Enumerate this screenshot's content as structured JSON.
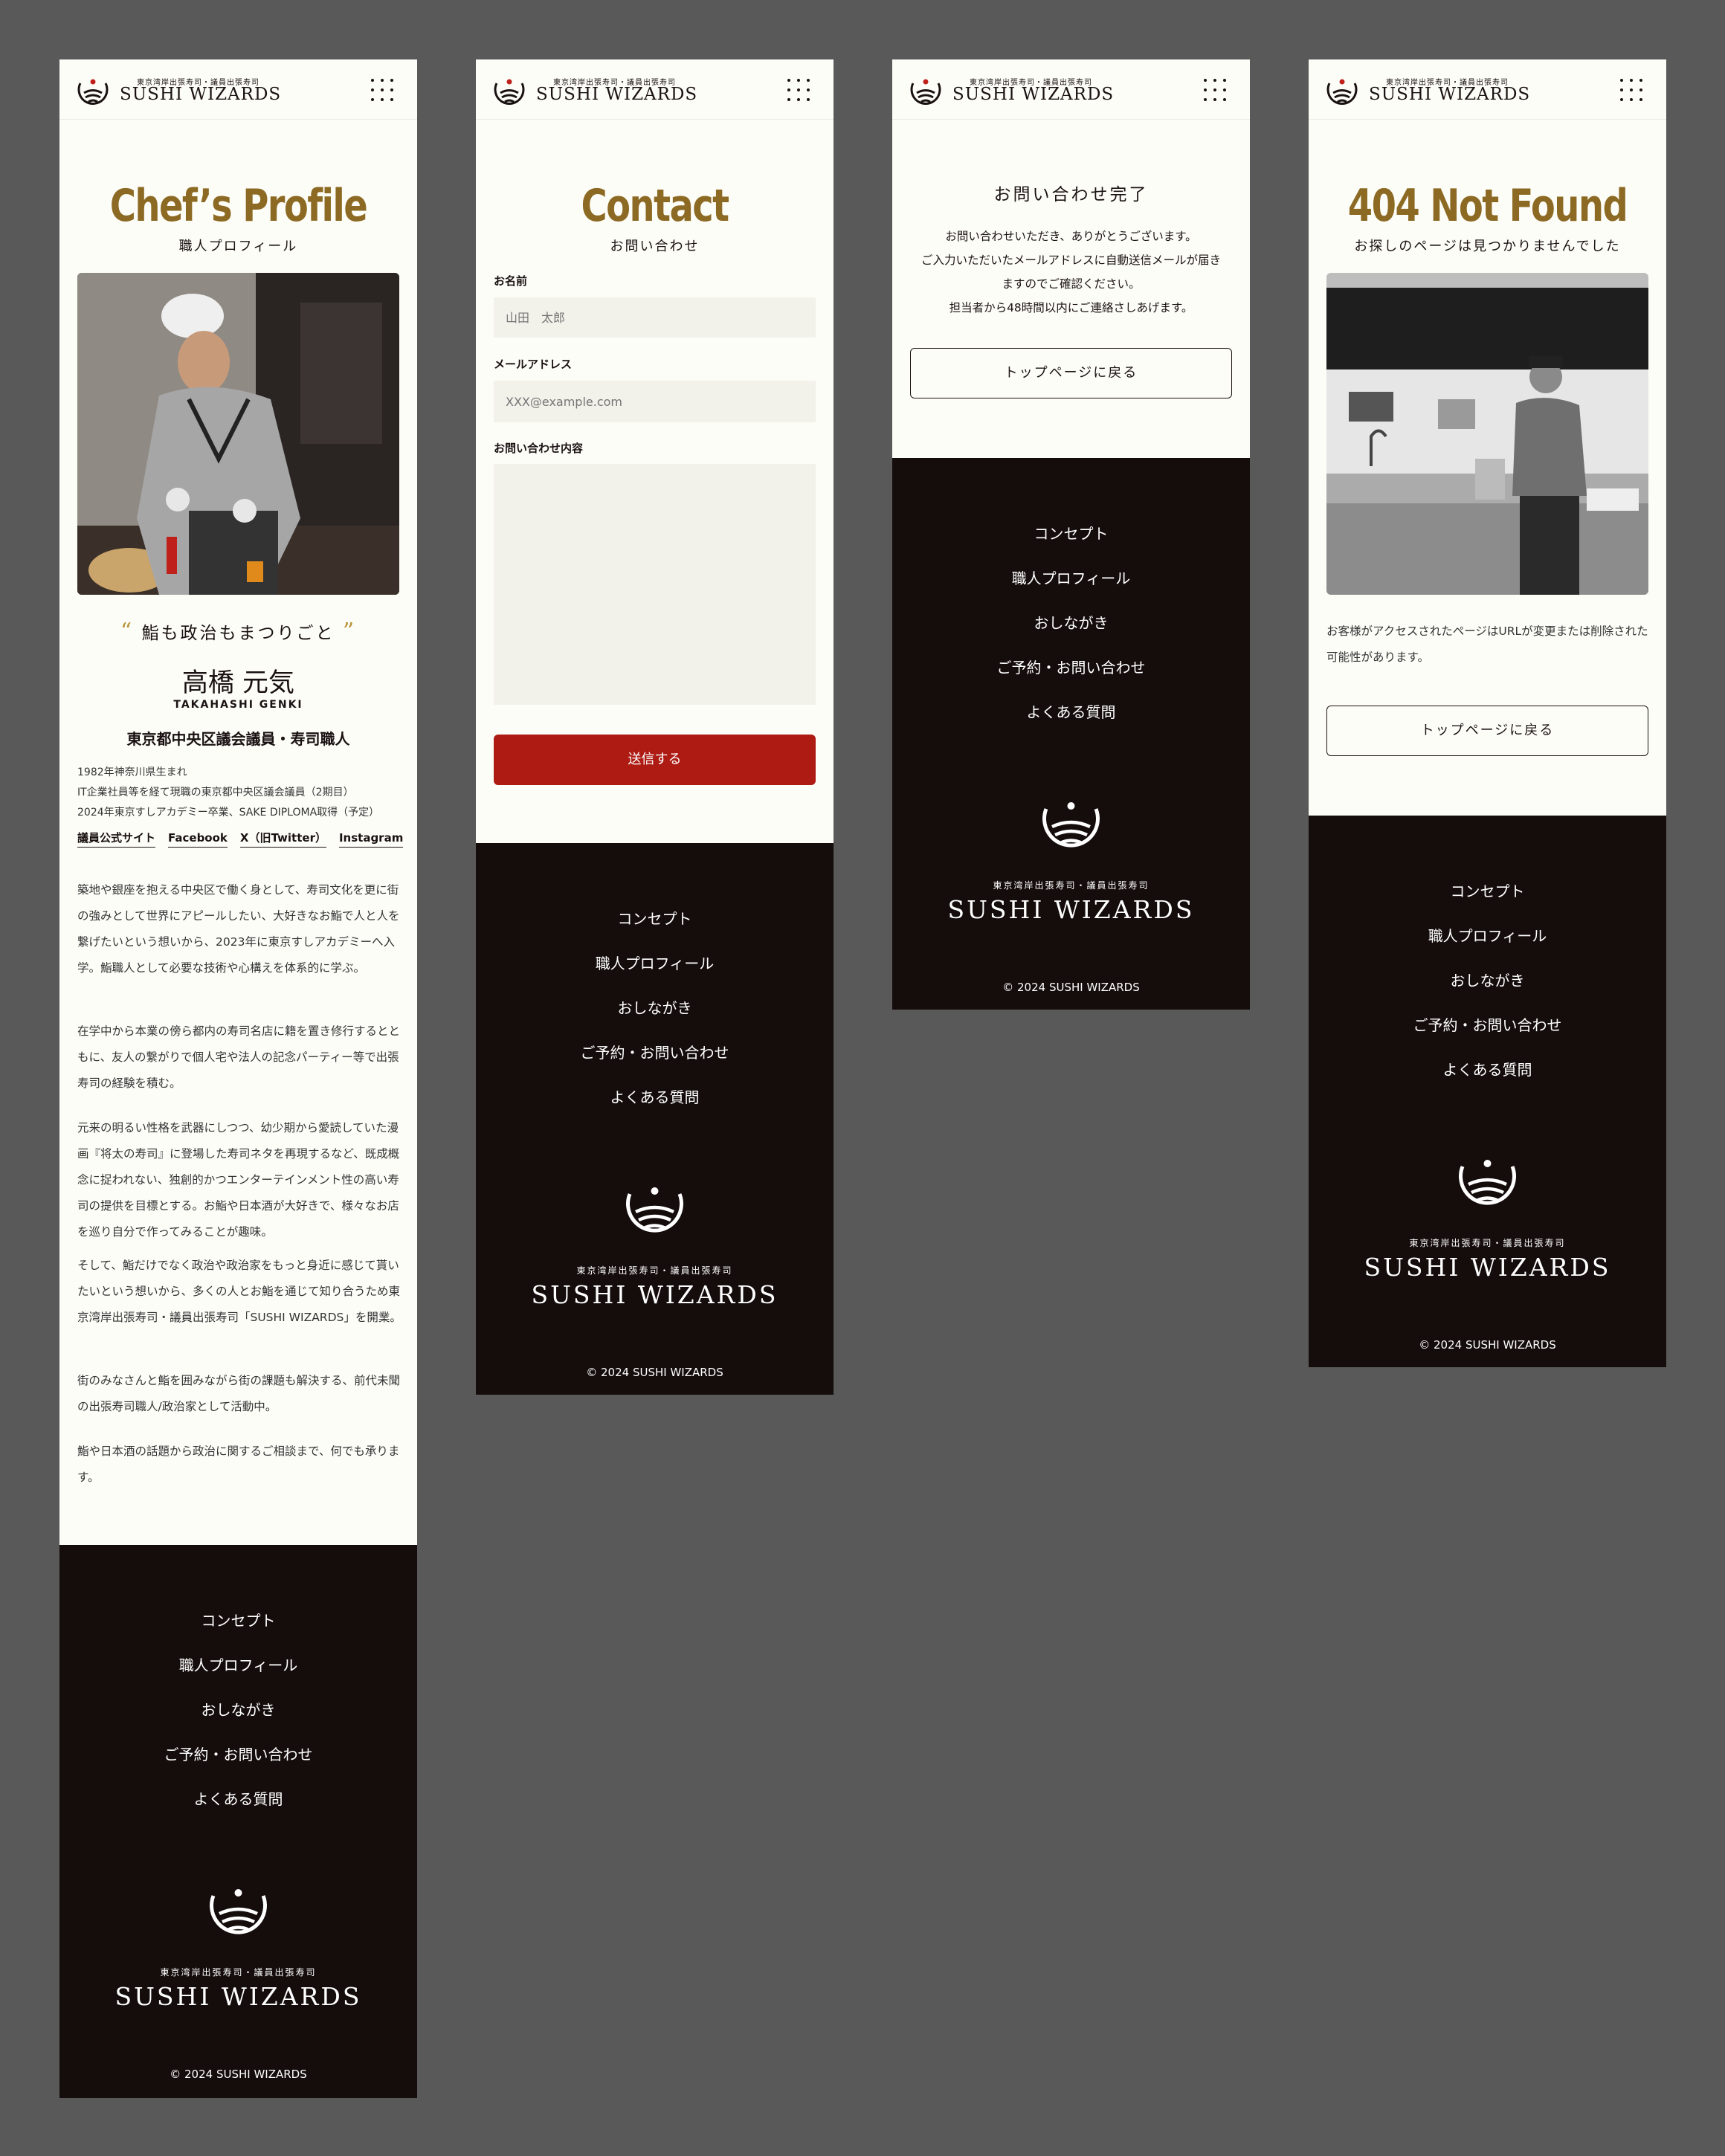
{
  "brand": {
    "sub": "東京湾岸出張寿司・議員出張寿司",
    "name": "SUSHI WIZARDS"
  },
  "footer": {
    "nav": [
      "コンセプト",
      "職人プロフィール",
      "おしながき",
      "ご予約・お問い合わせ",
      "よくある質問"
    ],
    "sub": "東京湾岸出張寿司・議員出張寿司",
    "name": "SUSHI WIZARDS",
    "copyright": "© 2024 SUSHI WIZARDS"
  },
  "profile": {
    "title": "Chef’s Profile",
    "subtitle": "職人プロフィール",
    "quote_open": "“",
    "quote": "鮨も政治もまつりごと",
    "quote_close": "”",
    "name": "高橋 元気",
    "name_roman": "TAKAHASHI GENKI",
    "role": "東京都中央区議会議員・寿司職人",
    "bio": [
      "1982年神奈川県生まれ",
      "IT企業社員等を経て現職の東京都中央区議会議員（2期目）",
      "2024年東京すしアカデミー卒業、SAKE DIPLOMA取得（予定）"
    ],
    "links": [
      "議員公式サイト",
      "Facebook",
      "X（旧Twitter）",
      "Instagram"
    ],
    "paragraphs": [
      "築地や銀座を抱える中央区で働く身として、寿司文化を更に街の強みとして世界にアピールしたい、大好きなお鮨で人と人を繋げたいという想いから、2023年に東京すしアカデミーへ入学。鮨職人として必要な技術や心構えを体系的に学ぶ。",
      "在学中から本業の傍ら都内の寿司名店に籍を置き修行するとともに、友人の繋がりで個人宅や法人の記念パーティー等で出張寿司の経験を積む。",
      "元来の明るい性格を武器にしつつ、幼少期から愛読していた漫画『将太の寿司』に登場した寿司ネタを再現するなど、既成概念に捉われない、独創的かつエンターテインメント性の高い寿司の提供を目標とする。お鮨や日本酒が大好きで、様々なお店を巡り自分で作ってみることが趣味。",
      "そして、鮨だけでなく政治や政治家をもっと身近に感じて貰いたいという想いから、多くの人とお鮨を通じて知り合うため東京湾岸出張寿司・議員出張寿司「SUSHI WIZARDS」を開業。",
      "街のみなさんと鮨を囲みながら街の課題も解決する、前代未聞の出張寿司職人/政治家として活動中。",
      "鮨や日本酒の話題から政治に関するご相談まで、何でも承ります。"
    ]
  },
  "contact": {
    "title": "Contact",
    "subtitle": "お問い合わせ",
    "name_label": "お名前",
    "name_placeholder": "山田　太郎",
    "email_label": "メールアドレス",
    "email_placeholder": "XXX@example.com",
    "message_label": "お問い合わせ内容",
    "submit_label": "送信する"
  },
  "thanks": {
    "title": "お問い合わせ完了",
    "lines": [
      "お問い合わせいただき、ありがとうございます。",
      "ご入力いただいたメールアドレスに自動送信メールが届き",
      "ますのでご確認ください。",
      "担当者から48時間以内にご連絡さしあげます。"
    ],
    "back_label": "トップページに戻る"
  },
  "notfound": {
    "title": "404 Not Found",
    "subtitle": "お探しのページは見つかりませんでした",
    "text": "お客様がアクセスされたページはURLが変更または削除された可能性があります。",
    "back_label": "トップページに戻る"
  },
  "colors": {
    "accent_gold": "#8d6a24",
    "button_red": "#ad1b13",
    "footer_bg": "#150c0c",
    "page_bg": "#fdfdf8",
    "canvas_bg": "#595959"
  },
  "icons": {
    "logo": "sushi-wave-logo-icon",
    "menu": "menu-dots-icon"
  }
}
